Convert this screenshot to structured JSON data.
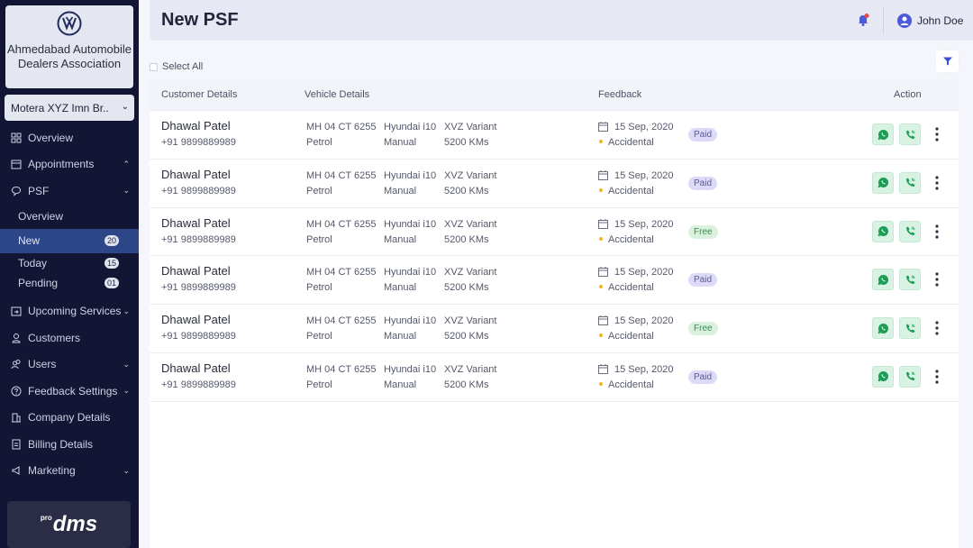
{
  "sidebar": {
    "brand_name": "Ahmedabad Automobile Dealers Association",
    "branch_selector": "Motera XYZ Imn Br..",
    "items": [
      {
        "label": "Overview",
        "icon": "grid-icon",
        "chevron": ""
      },
      {
        "label": "Appointments",
        "icon": "calendar-icon",
        "chevron": "up"
      },
      {
        "label": "PSF",
        "icon": "chat-icon",
        "chevron": "down"
      }
    ],
    "psf_subitems": [
      {
        "label": "Overview",
        "badge": ""
      },
      {
        "label": "New",
        "badge": "20"
      },
      {
        "label": "Today",
        "badge": "15"
      },
      {
        "label": "Pending",
        "badge": "01"
      }
    ],
    "items_after": [
      {
        "label": "Upcoming Services",
        "icon": "calendar-arrow-icon",
        "chevron": "down"
      },
      {
        "label": "Customers",
        "icon": "person-icon",
        "chevron": ""
      },
      {
        "label": "Users",
        "icon": "users-icon",
        "chevron": "down"
      },
      {
        "label": "Feedback Settings",
        "icon": "help-circle-icon",
        "chevron": "down"
      },
      {
        "label": "Company Details",
        "icon": "building-icon",
        "chevron": ""
      },
      {
        "label": "Billing Details",
        "icon": "document-icon",
        "chevron": ""
      },
      {
        "label": "Marketing",
        "icon": "megaphone-icon",
        "chevron": "down"
      }
    ],
    "footer_logo": {
      "prefix": "pro",
      "text": "dms"
    }
  },
  "header": {
    "title": "New PSF",
    "user_name": "John Doe"
  },
  "toolbar": {
    "select_all_label": "Select All"
  },
  "table": {
    "columns": [
      "Customer Details",
      "Vehicle Details",
      "Feedback",
      "Action"
    ],
    "rows": [
      {
        "name": "Dhawal Patel",
        "phone": "+91 9899889989",
        "reg_no": "MH 04 CT 6255",
        "fuel": "Petrol",
        "model": "Hyundai i10",
        "transmission": "Manual",
        "variant": "XVZ Variant",
        "kms": "5200 KMs",
        "date": "15 Sep, 2020",
        "type": "Accidental",
        "status": "Paid"
      },
      {
        "name": "Dhawal Patel",
        "phone": "+91 9899889989",
        "reg_no": "MH 04 CT 6255",
        "fuel": "Petrol",
        "model": "Hyundai i10",
        "transmission": "Manual",
        "variant": "XVZ Variant",
        "kms": "5200 KMs",
        "date": "15 Sep, 2020",
        "type": "Accidental",
        "status": "Paid"
      },
      {
        "name": "Dhawal Patel",
        "phone": "+91 9899889989",
        "reg_no": "MH 04 CT 6255",
        "fuel": "Petrol",
        "model": "Hyundai i10",
        "transmission": "Manual",
        "variant": "XVZ Variant",
        "kms": "5200 KMs",
        "date": "15 Sep, 2020",
        "type": "Accidental",
        "status": "Free"
      },
      {
        "name": "Dhawal Patel",
        "phone": "+91 9899889989",
        "reg_no": "MH 04 CT 6255",
        "fuel": "Petrol",
        "model": "Hyundai i10",
        "transmission": "Manual",
        "variant": "XVZ Variant",
        "kms": "5200 KMs",
        "date": "15 Sep, 2020",
        "type": "Accidental",
        "status": "Paid"
      },
      {
        "name": "Dhawal Patel",
        "phone": "+91 9899889989",
        "reg_no": "MH 04 CT 6255",
        "fuel": "Petrol",
        "model": "Hyundai i10",
        "transmission": "Manual",
        "variant": "XVZ Variant",
        "kms": "5200 KMs",
        "date": "15 Sep, 2020",
        "type": "Accidental",
        "status": "Free"
      },
      {
        "name": "Dhawal Patel",
        "phone": "+91 9899889989",
        "reg_no": "MH 04 CT 6255",
        "fuel": "Petrol",
        "model": "Hyundai i10",
        "transmission": "Manual",
        "variant": "XVZ Variant",
        "kms": "5200 KMs",
        "date": "15 Sep, 2020",
        "type": "Accidental",
        "status": "Paid"
      }
    ]
  },
  "colors": {
    "sidebar_bg": "#121533",
    "active_item": "#2d4687",
    "accent": "#3b4fd6",
    "whatsapp_green": "#1e9c55"
  }
}
